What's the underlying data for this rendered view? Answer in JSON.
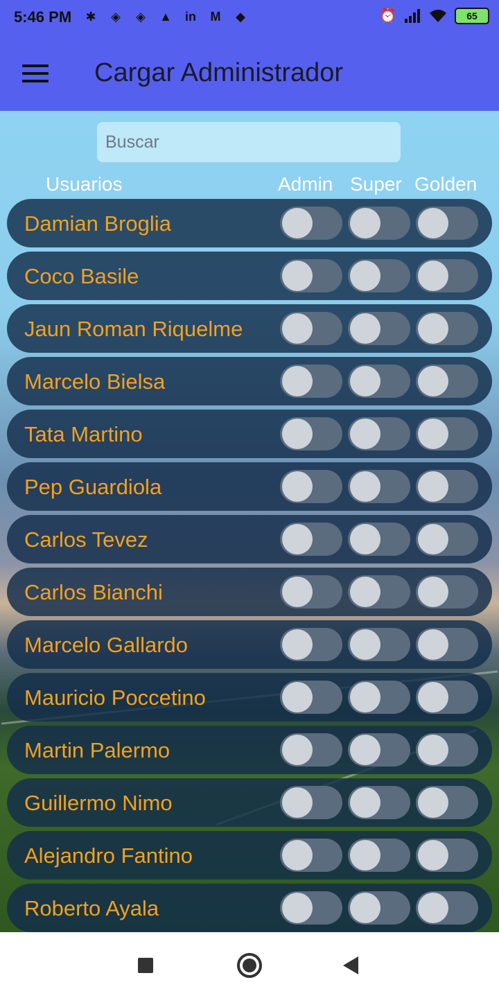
{
  "status_bar": {
    "time": "5:46 PM",
    "notification_icons": [
      "slack-icon",
      "app-icon",
      "app-icon",
      "arc-icon",
      "linkedin-icon",
      "gmail-icon",
      "dropbox-icon"
    ],
    "right_icons": [
      "alarm-icon",
      "signal-icon",
      "wifi-icon"
    ],
    "battery": "65"
  },
  "app_bar": {
    "title": "Cargar Administrador",
    "menu_icon": "hamburger-menu-icon",
    "color": "#5660ee"
  },
  "search": {
    "placeholder": "Buscar"
  },
  "table_header": {
    "users": "Usuarios",
    "admin": "Admin",
    "super": "Super",
    "golden": "Golden"
  },
  "users": [
    {
      "name": "Damian Broglia",
      "admin": false,
      "super": false,
      "golden": false
    },
    {
      "name": "Coco Basile",
      "admin": false,
      "super": false,
      "golden": false
    },
    {
      "name": "Jaun Roman Riquelme",
      "admin": false,
      "super": false,
      "golden": false
    },
    {
      "name": "Marcelo Bielsa",
      "admin": false,
      "super": false,
      "golden": false
    },
    {
      "name": "Tata Martino",
      "admin": false,
      "super": false,
      "golden": false
    },
    {
      "name": "Pep Guardiola",
      "admin": false,
      "super": false,
      "golden": false
    },
    {
      "name": "Carlos Tevez",
      "admin": false,
      "super": false,
      "golden": false
    },
    {
      "name": "Carlos Bianchi",
      "admin": false,
      "super": false,
      "golden": false
    },
    {
      "name": "Marcelo Gallardo",
      "admin": false,
      "super": false,
      "golden": false
    },
    {
      "name": "Mauricio Poccetino",
      "admin": false,
      "super": false,
      "golden": false
    },
    {
      "name": "Martin Palermo",
      "admin": false,
      "super": false,
      "golden": false
    },
    {
      "name": "Guillermo Nimo",
      "admin": false,
      "super": false,
      "golden": false
    },
    {
      "name": "Alejandro Fantino",
      "admin": false,
      "super": false,
      "golden": false
    },
    {
      "name": "Roberto Ayala",
      "admin": false,
      "super": false,
      "golden": false
    }
  ],
  "colors": {
    "user_name": "#f3a11f",
    "row_background": "#142d4b",
    "toggle_track": "#5a6c7e",
    "toggle_knob": "#cfd3da"
  },
  "nav_bar": [
    "recent-apps-icon",
    "home-icon",
    "back-icon"
  ]
}
